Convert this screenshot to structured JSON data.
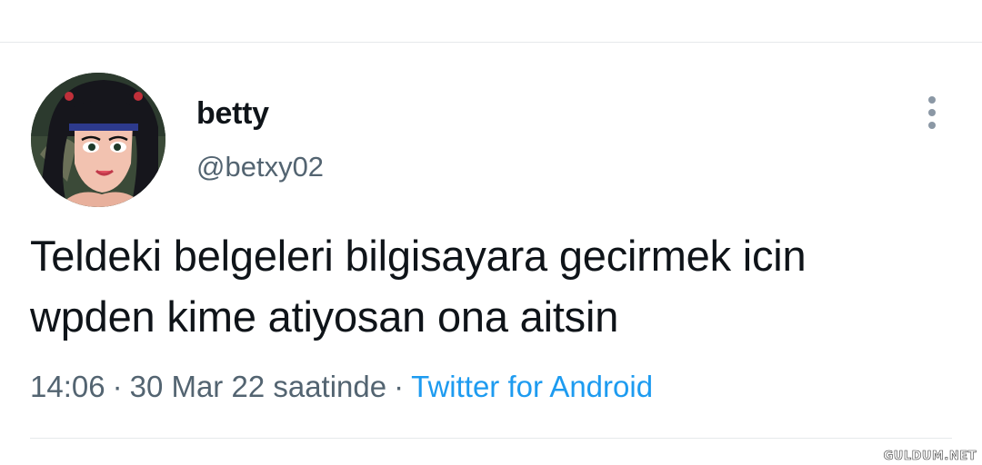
{
  "tweet": {
    "display_name": "betty",
    "handle": "@betxy02",
    "text_line1": "Teldeki belgeleri bilgisayara gecirmek icin",
    "text_line2": "wpden kime atiyosan ona aitsin",
    "time": "14:06",
    "date": "30 Mar 22 saatinde",
    "separator": "·",
    "source": "Twitter for Android"
  },
  "icons": {
    "more": "more-vertical-icon"
  },
  "colors": {
    "text": "#0f1419",
    "secondary": "#536471",
    "link": "#1d9bf0",
    "divider": "#e6e9eb"
  },
  "watermark": "GULDUM.NET"
}
